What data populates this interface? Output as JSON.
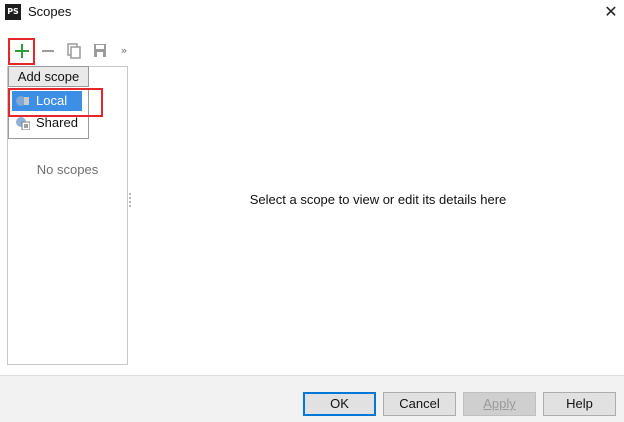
{
  "window": {
    "logo_text": "PS",
    "title": "Scopes",
    "close_glyph": "✕"
  },
  "toolbar": {
    "add_icon": "plus-icon",
    "remove_icon": "minus-icon",
    "copy_icon": "copy-icon",
    "save_icon": "save-icon",
    "more_glyph": "»"
  },
  "scope_list": {
    "empty_text": "No scopes"
  },
  "add_scope_menu": {
    "title": "Add scope",
    "items": [
      {
        "label": "Local",
        "icon": "local-scope-icon"
      },
      {
        "label": "Shared",
        "icon": "shared-scope-icon"
      }
    ]
  },
  "details": {
    "placeholder": "Select a scope to view or edit its details here"
  },
  "footer": {
    "ok_label": "OK",
    "cancel_label": "Cancel",
    "apply_label": "Apply",
    "help_label": "Help"
  },
  "colors": {
    "accent": "#3d8ee5",
    "highlight": "#e5262b",
    "add_green": "#2e9c3c"
  }
}
